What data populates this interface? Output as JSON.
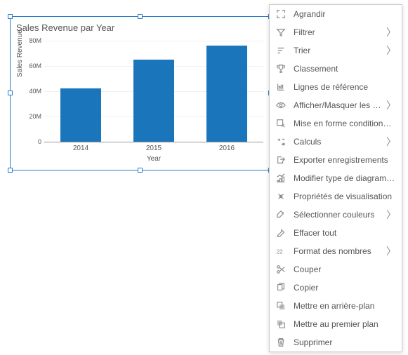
{
  "chart": {
    "title": "Sales Revenue par Year",
    "ylabel": "Sales Revenue",
    "xlabel": "Year"
  },
  "chart_data": {
    "type": "bar",
    "title": "Sales Revenue par Year",
    "xlabel": "Year",
    "ylabel": "Sales Revenue",
    "categories": [
      "2014",
      "2015",
      "2016"
    ],
    "values": [
      42000000,
      65000000,
      76000000
    ],
    "ylim": [
      0,
      80000000
    ],
    "yticks": [
      0,
      20000000,
      40000000,
      60000000,
      80000000
    ],
    "ytick_labels": [
      "0",
      "20M",
      "40M",
      "60M",
      "80M"
    ]
  },
  "menu": {
    "items": [
      {
        "icon": "expand-icon",
        "label": "Agrandir",
        "sub": false
      },
      {
        "icon": "filter-icon",
        "label": "Filtrer",
        "sub": true
      },
      {
        "icon": "sort-icon",
        "label": "Trier",
        "sub": true
      },
      {
        "icon": "trophy-icon",
        "label": "Classement",
        "sub": false
      },
      {
        "icon": "reference-lines-icon",
        "label": "Lignes de référence",
        "sub": false
      },
      {
        "icon": "eye-icon",
        "label": "Afficher/Masquer les propriétés",
        "sub": true
      },
      {
        "icon": "conditional-format-icon",
        "label": "Mise en forme conditionnelle",
        "sub": false
      },
      {
        "icon": "calc-icon",
        "label": "Calculs",
        "sub": true
      },
      {
        "icon": "export-icon",
        "label": "Exporter enregistrements",
        "sub": false
      },
      {
        "icon": "chart-type-icon",
        "label": "Modifier type de diagramme",
        "sub": false
      },
      {
        "icon": "viz-props-icon",
        "label": "Propriétés de visualisation",
        "sub": false
      },
      {
        "icon": "colors-icon",
        "label": "Sélectionner couleurs",
        "sub": true
      },
      {
        "icon": "eraser-icon",
        "label": "Effacer tout",
        "sub": false
      },
      {
        "icon": "number-format-icon",
        "label": "Format des nombres",
        "sub": true
      },
      {
        "icon": "cut-icon",
        "label": "Couper",
        "sub": false
      },
      {
        "icon": "copy-icon",
        "label": "Copier",
        "sub": false
      },
      {
        "icon": "send-back-icon",
        "label": "Mettre en arrière-plan",
        "sub": false
      },
      {
        "icon": "bring-front-icon",
        "label": "Mettre au premier plan",
        "sub": false
      },
      {
        "icon": "trash-icon",
        "label": "Supprimer",
        "sub": false
      }
    ]
  }
}
